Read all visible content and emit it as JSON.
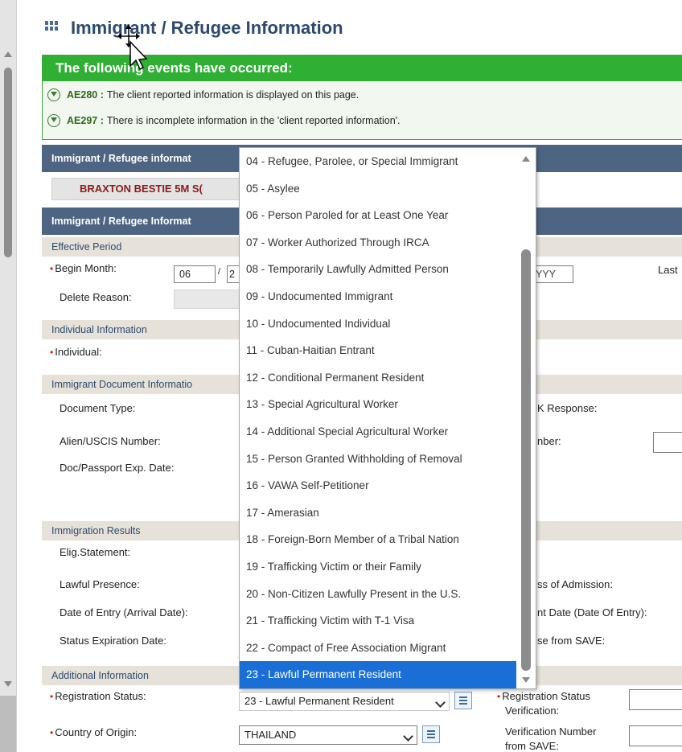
{
  "page": {
    "title": "Immigrant / Refugee Information"
  },
  "events": {
    "header": "The following events have occurred:",
    "items": [
      {
        "code": "AE280 :",
        "text": "The client reported information is displayed on this page."
      },
      {
        "code": "AE297 :",
        "text": "There is incomplete information in the 'client reported information'."
      }
    ]
  },
  "sections": {
    "info_header_1": "Immigrant / Refugee informat",
    "client_name": "BRAXTON BESTIE 5M S(",
    "info_header_2": "Immigrant / Refugee Informat",
    "effective_period": "Effective Period",
    "individual_info": "Individual Information",
    "doc_info": "Immigrant Document Informatio",
    "immigration_results": "Immigration Results",
    "additional_info": "Additional Information"
  },
  "fields": {
    "begin_month_label": "Begin Month:",
    "begin_month_value": "06",
    "begin_year_value": "2",
    "end_year_placeholder": "YYY",
    "last_label": "Last",
    "delete_reason_label": "Delete Reason:",
    "individual_label": "Individual:",
    "document_type_label": "Document Type:",
    "response_label": "K Response:",
    "alien_label": "Alien/USCIS Number:",
    "number_label": "nber:",
    "doc_exp_label": "Doc/Passport Exp. Date:",
    "elig_label": "Elig.Statement:",
    "lawful_presence_label": "Lawful Presence:",
    "class_admission_label": "ss of Admission:",
    "date_entry_label": "Date of Entry (Arrival Date):",
    "date_entry_right_label": "nt Date (Date Of Entry):",
    "status_exp_label": "Status Expiration Date:",
    "save_label": "se from SAVE:",
    "registration_status_label": "Registration Status:",
    "registration_status_value": "23 - Lawful Permanent Resident",
    "reg_verification_label_1": "Registration Status",
    "reg_verification_label_2": "Verification:",
    "country_label": "Country of Origin:",
    "country_value": "THAILAND",
    "verification_number_label_1": "Verification Number",
    "verification_number_label_2": "from SAVE:"
  },
  "dropdown": {
    "options": [
      "04 - Refugee, Parolee, or Special Immigrant",
      "05 - Asylee",
      "06 - Person Paroled for at Least One Year",
      "07 - Worker Authorized Through IRCA",
      "08 - Temporarily Lawfully Admitted Person",
      "09 - Undocumented Immigrant",
      "10 - Undocumented Individual",
      "11 - Cuban-Haitian Entrant",
      "12 - Conditional Permanent Resident",
      "13 - Special Agricultural Worker",
      "14 - Additional Special Agricultural Worker",
      "15 - Person Granted Withholding of Removal",
      "16 - VAWA Self-Petitioner",
      "17 - Amerasian",
      "18 - Foreign-Born Member of a Tribal Nation",
      "19 - Trafficking Victim or their Family",
      "20 - Non-Citizen Lawfully Present in the U.S.",
      "21 - Trafficking Victim with T-1 Visa",
      "22 - Compact of Free Association Migrant",
      "23 - Lawful Permanent Resident"
    ],
    "selected_index": 19
  },
  "colors": {
    "events_green": "#2fb034",
    "section_dark": "#4d6583",
    "selected_blue": "#1a6fd6",
    "name_red": "#8b1a1a"
  }
}
